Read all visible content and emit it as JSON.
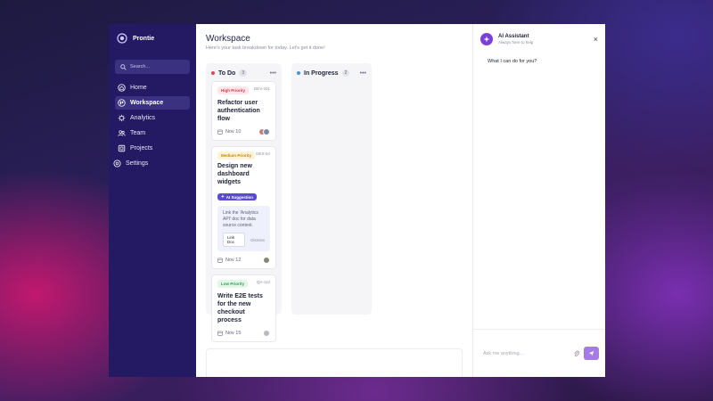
{
  "app": {
    "name": "Prontie"
  },
  "sidebar": {
    "search_placeholder": "Search...",
    "items": [
      {
        "label": "Home",
        "icon": "home-icon"
      },
      {
        "label": "Workspace",
        "icon": "workspace-icon",
        "active": true
      },
      {
        "label": "Analytics",
        "icon": "analytics-icon"
      },
      {
        "label": "Team",
        "icon": "team-icon"
      },
      {
        "label": "Projects",
        "icon": "projects-icon"
      },
      {
        "label": "Settings",
        "icon": "settings-icon"
      }
    ]
  },
  "main": {
    "title": "Workspace",
    "subtitle": "Here's your task breakdown for today. Let's get it done!"
  },
  "board": {
    "columns": [
      {
        "title": "To Do",
        "count": "3",
        "dot_color": "#e0445a",
        "cards": [
          {
            "priority": "High Priority",
            "id": "DEV-201",
            "title": "Refactor user authentication flow",
            "date": "Nov 10"
          },
          {
            "priority": "Medium Priority",
            "id": "DES-54",
            "title": "Design new dashboard widgets",
            "ai_tag": "AI Suggestion",
            "ai_text": "Link the 'Analytics API' doc for data source context.",
            "ai_action": "Link Doc",
            "ai_dismiss": "Dismiss",
            "date": "Nov 12"
          },
          {
            "priority": "Low Priority",
            "id": "QA-112",
            "title": "Write E2E tests for the new checkout process",
            "date": "Nov 15"
          }
        ]
      },
      {
        "title": "In Progress",
        "count": "2",
        "dot_color": "#4a90d9"
      }
    ]
  },
  "assistant": {
    "title": "AI Assistant",
    "subtitle": "Always here to help",
    "close": "×",
    "message": "What I can do for you?",
    "input_placeholder": "Ask me anything..."
  },
  "colors": {
    "sidebar": "#231a63",
    "accent": "#5a4bd6",
    "send": "#a77be6"
  }
}
